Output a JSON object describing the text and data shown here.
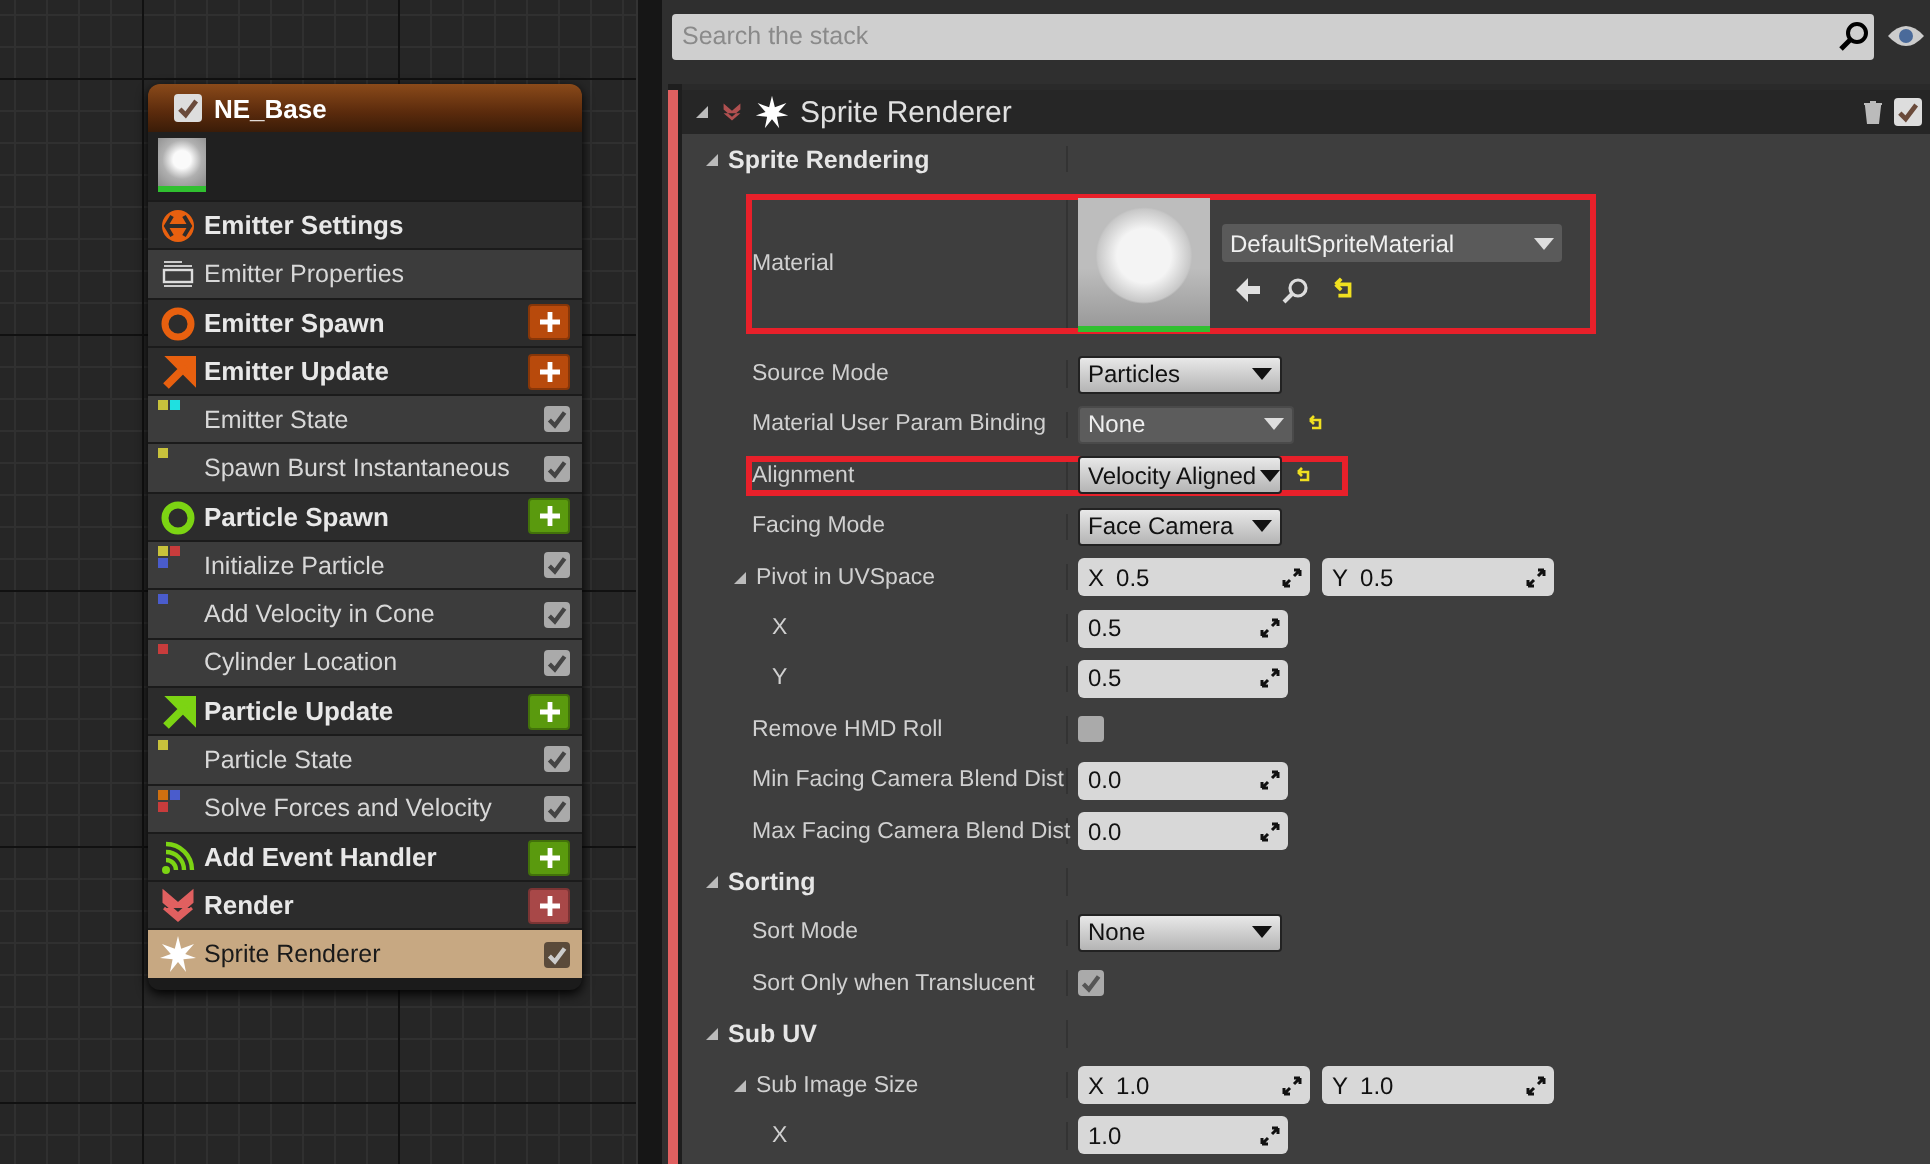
{
  "node": {
    "title": "NE_Base",
    "enabled": true,
    "items": [
      {
        "kind": "group",
        "label": "Emitter Settings",
        "selected": false
      },
      {
        "kind": "properties",
        "label": "Emitter Properties",
        "selected": false
      },
      {
        "kind": "group",
        "label": "Emitter Spawn",
        "color": "#b84a0c",
        "selected": false
      },
      {
        "kind": "group",
        "label": "Emitter Update",
        "color": "#b84a0c",
        "selected": false
      },
      {
        "kind": "module",
        "label": "Emitter State",
        "checked": true,
        "selected": false
      },
      {
        "kind": "module",
        "label": "Spawn Burst Instantaneous",
        "checked": true,
        "selected": false
      },
      {
        "kind": "group",
        "label": "Particle Spawn",
        "color": "#5a9a0e",
        "selected": false
      },
      {
        "kind": "module",
        "label": "Initialize Particle",
        "checked": true,
        "selected": false
      },
      {
        "kind": "module",
        "label": "Add Velocity in Cone",
        "checked": true,
        "selected": false
      },
      {
        "kind": "module",
        "label": "Cylinder Location",
        "checked": true,
        "selected": false
      },
      {
        "kind": "group",
        "label": "Particle Update",
        "color": "#5a9a0e",
        "selected": false
      },
      {
        "kind": "module",
        "label": "Particle State",
        "checked": true,
        "selected": false
      },
      {
        "kind": "module",
        "label": "Solve Forces and Velocity",
        "checked": true,
        "selected": false
      },
      {
        "kind": "group",
        "label": "Add Event Handler",
        "color": "#5a9a0e",
        "selected": false
      },
      {
        "kind": "group",
        "label": "Render",
        "color": "#a84848",
        "selected": false
      },
      {
        "kind": "module",
        "label": "Sprite Renderer",
        "checked": true,
        "selected": true
      }
    ]
  },
  "search": {
    "placeholder": "Search the stack"
  },
  "stack": {
    "title": "Sprite Renderer",
    "enabled": true,
    "expanded": true,
    "rows": [
      {
        "kind": "section",
        "label": "Sprite Rendering",
        "expanded": true,
        "children": [
          {
            "kind": "material",
            "label": "Material",
            "value": "DefaultSpriteMaterial",
            "modified": true,
            "highlighted": true
          },
          {
            "kind": "dropdown",
            "label": "Source Mode",
            "value": "Particles",
            "modified": false,
            "highlighted": false
          },
          {
            "kind": "binding",
            "label": "Material User Param Binding",
            "value": "None",
            "modified": true,
            "highlighted": false
          },
          {
            "kind": "dropdown",
            "label": "Alignment",
            "value": "Velocity Aligned",
            "modified": true,
            "highlighted": true
          },
          {
            "kind": "dropdown",
            "label": "Facing Mode",
            "value": "Face Camera",
            "modified": false,
            "highlighted": false
          },
          {
            "kind": "vector",
            "label": "Pivot in UVSpace",
            "expanded": true,
            "components": [
              {
                "axis": "X",
                "value": "0.5"
              },
              {
                "axis": "Y",
                "value": "0.5"
              }
            ],
            "children": [
              {
                "kind": "number",
                "label": "X",
                "value": "0.5"
              },
              {
                "kind": "number",
                "label": "Y",
                "value": "0.5"
              }
            ]
          },
          {
            "kind": "checkbox",
            "label": "Remove HMD Roll",
            "checked": false
          },
          {
            "kind": "number",
            "label": "Min Facing Camera Blend Dist",
            "value": "0.0"
          },
          {
            "kind": "number",
            "label": "Max Facing Camera Blend Dist",
            "value": "0.0"
          }
        ]
      },
      {
        "kind": "section",
        "label": "Sorting",
        "expanded": true,
        "children": [
          {
            "kind": "dropdown",
            "label": "Sort Mode",
            "value": "None",
            "modified": false,
            "highlighted": false
          },
          {
            "kind": "checkbox",
            "label": "Sort Only when Translucent",
            "checked": true
          }
        ]
      },
      {
        "kind": "section",
        "label": "Sub UV",
        "expanded": true,
        "children": [
          {
            "kind": "vector",
            "label": "Sub Image Size",
            "expanded": true,
            "components": [
              {
                "axis": "X",
                "value": "1.0"
              },
              {
                "axis": "Y",
                "value": "1.0"
              }
            ],
            "children": [
              {
                "kind": "number",
                "label": "X",
                "value": "1.0"
              }
            ]
          }
        ]
      }
    ]
  }
}
